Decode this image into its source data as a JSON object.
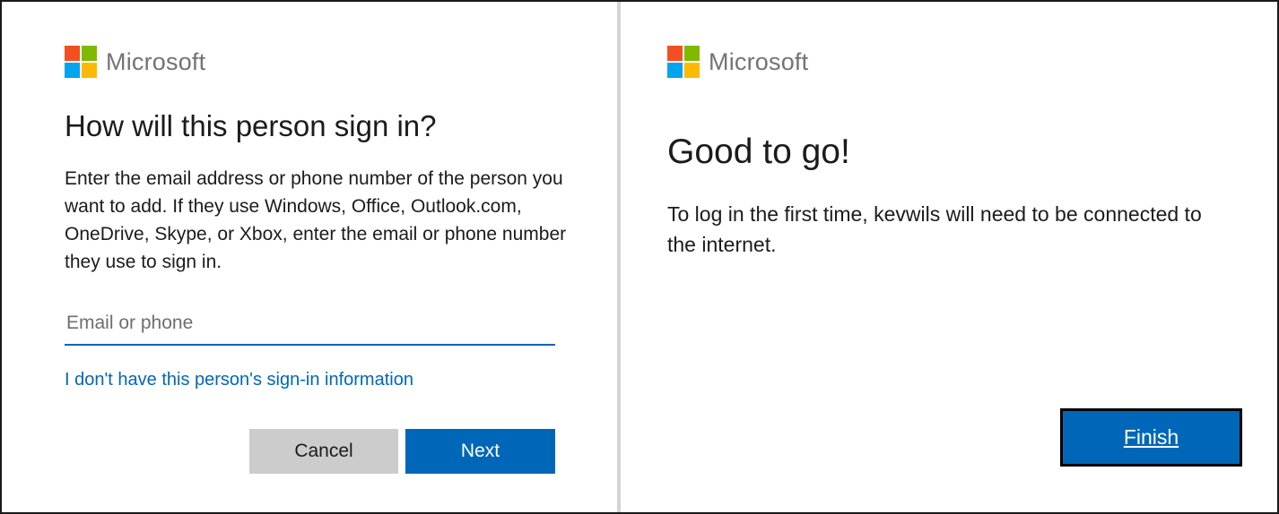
{
  "left_dialog": {
    "brand": {
      "name": "Microsoft",
      "logo_icon": "microsoft-logo-icon"
    },
    "title": "How will this person sign in?",
    "description": "Enter the email address or phone number of the person you want to add. If they use Windows, Office, Outlook.com, OneDrive, Skype, or Xbox, enter the email or phone number they use to sign in.",
    "email_input": {
      "value": "",
      "placeholder": "Email or phone"
    },
    "no_info_link": "I don't have this person's sign-in information",
    "buttons": {
      "cancel": "Cancel",
      "next": "Next"
    }
  },
  "right_dialog": {
    "brand": {
      "name": "Microsoft",
      "logo_icon": "microsoft-logo-icon"
    },
    "title": "Good to go!",
    "description": "To log in the first time, kevwils will need to be connected to the internet.",
    "buttons": {
      "finish": "Finish"
    }
  },
  "colors": {
    "accent": "#0067b8",
    "logo_red": "#f25022",
    "logo_green": "#7fba00",
    "logo_blue": "#00a4ef",
    "logo_yellow": "#ffb900",
    "cancel_button": "#cccccc"
  }
}
